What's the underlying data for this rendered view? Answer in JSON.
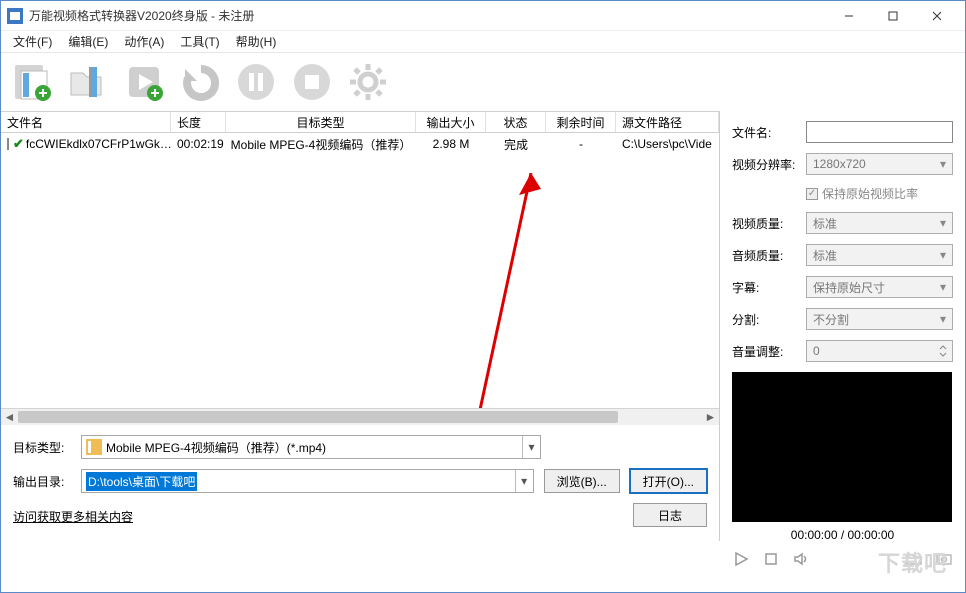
{
  "window": {
    "title": "万能视频格式转换器V2020终身版 - 未注册"
  },
  "menu": {
    "file": "文件(F)",
    "edit": "编辑(E)",
    "action": "动作(A)",
    "tools": "工具(T)",
    "help": "帮助(H)"
  },
  "columns": {
    "filename": "文件名",
    "length": "长度",
    "targetType": "目标类型",
    "outSize": "输出大小",
    "status": "状态",
    "remain": "剩余时间",
    "srcPath": "源文件路径"
  },
  "row": {
    "filename": "fcCWIEkdlx07CFrP1wGk…",
    "length": "00:02:19",
    "targetType": "Mobile MPEG-4视频编码（推荐）",
    "outSize": "2.98 M",
    "status": "完成",
    "remain": "-",
    "srcPath": "C:\\Users\\pc\\Vide"
  },
  "form": {
    "targetTypeLabel": "目标类型:",
    "targetTypeValue": "Mobile MPEG-4视频编码（推荐）(*.mp4)",
    "outputDirLabel": "输出目录:",
    "outputDirValue": "D:\\tools\\桌面\\下载吧",
    "browse": "浏览(B)...",
    "open": "打开(O)...",
    "log": "日志",
    "relatedLink": "访问获取更多相关内容"
  },
  "props": {
    "filenameLabel": "文件名:",
    "resolutionLabel": "视频分辨率:",
    "resolutionValue": "1280x720",
    "keepRatio": "保持原始视频比率",
    "videoQualityLabel": "视频质量:",
    "videoQualityValue": "标准",
    "audioQualityLabel": "音频质量:",
    "audioQualityValue": "标准",
    "subtitleLabel": "字幕:",
    "subtitleValue": "保持原始尺寸",
    "splitLabel": "分割:",
    "splitValue": "不分割",
    "volumeLabel": "音量调整:",
    "volumeValue": "0"
  },
  "preview": {
    "time": "00:00:00 / 00:00:00"
  },
  "watermark": "下载吧"
}
